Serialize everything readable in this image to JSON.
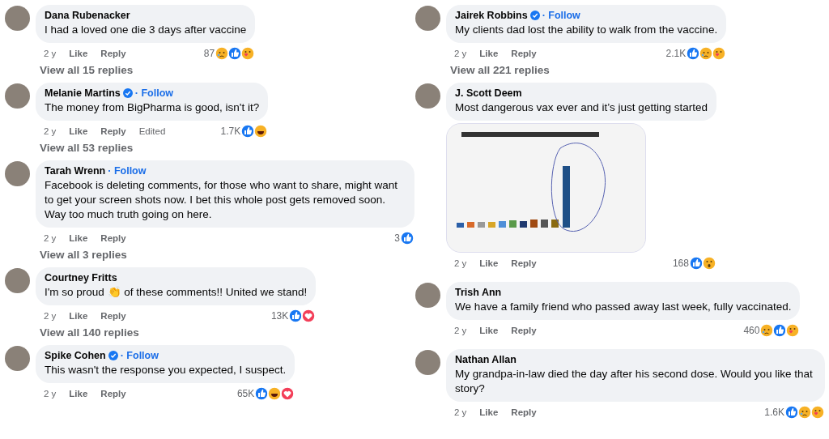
{
  "columns": [
    {
      "comments": [
        {
          "author": "Dana Rubenacker",
          "verified": false,
          "text": "I had a loved one die 3 days after vaccine",
          "time": "2 y",
          "like": "Like",
          "reply": "Reply",
          "count": "87",
          "reactions": [
            {
              "kind": "sad"
            },
            {
              "kind": "like"
            },
            {
              "kind": "care"
            }
          ],
          "view_replies": "View all 15 replies"
        },
        {
          "author": "Melanie Martins",
          "verified": true,
          "follow": "· Follow",
          "text": "The money from BigPharma is good, isn't it?",
          "time": "2 y",
          "like": "Like",
          "reply": "Reply",
          "edited": "Edited",
          "count": "1.7K",
          "reactions": [
            {
              "kind": "like"
            },
            {
              "kind": "haha"
            }
          ],
          "view_replies": "View all 53 replies"
        },
        {
          "author": "Tarah Wrenn",
          "verified": false,
          "follow": "· Follow",
          "text": "Facebook is deleting comments, for those who want to share, might want to get your screen shots now. I bet this whole post gets removed soon. Way too much truth going on here.",
          "time": "2 y",
          "like": "Like",
          "reply": "Reply",
          "count": "3",
          "reactions": [
            {
              "kind": "like"
            }
          ],
          "view_replies": "View all 3 replies"
        },
        {
          "author": "Courtney Fritts",
          "verified": false,
          "text": "I'm so proud 👏 of these comments!! United we stand!",
          "time": "2 y",
          "like": "Like",
          "reply": "Reply",
          "count": "13K",
          "reactions": [
            {
              "kind": "like"
            },
            {
              "kind": "love"
            }
          ],
          "view_replies": "View all 140 replies"
        },
        {
          "author": "Spike Cohen",
          "verified": true,
          "follow": "· Follow",
          "text": "This wasn't the response you expected, I suspect.",
          "time": "2 y",
          "like": "Like",
          "reply": "Reply",
          "count": "65K",
          "reactions": [
            {
              "kind": "like"
            },
            {
              "kind": "haha"
            },
            {
              "kind": "love"
            }
          ]
        }
      ]
    },
    {
      "comments": [
        {
          "author": "Jairek Robbins",
          "verified": true,
          "follow": "· Follow",
          "text": "My clients dad lost the ability to walk from the vaccine.",
          "time": "2 y",
          "like": "Like",
          "reply": "Reply",
          "count": "2.1K",
          "reactions": [
            {
              "kind": "like"
            },
            {
              "kind": "sad"
            },
            {
              "kind": "care"
            }
          ],
          "view_replies": "View all 221 replies"
        },
        {
          "author": "J. Scott Deem",
          "verified": false,
          "text": "Most dangerous vax ever and it’s just getting started",
          "image": true,
          "time": "2 y",
          "like": "Like",
          "reply": "Reply",
          "count": "168",
          "reactions": [
            {
              "kind": "like"
            },
            {
              "kind": "wow"
            }
          ]
        },
        {
          "author": "Trish Ann",
          "verified": false,
          "text": "We have a family friend who passed away last week, fully vaccinated.",
          "time": "2 y",
          "like": "Like",
          "reply": "Reply",
          "count": "460",
          "reactions": [
            {
              "kind": "sad"
            },
            {
              "kind": "like"
            },
            {
              "kind": "care"
            }
          ]
        },
        {
          "author": "Nathan Allan",
          "verified": false,
          "text": "My grandpa-in-law died the day after his second dose. Would you like that story?",
          "time": "2 y",
          "like": "Like",
          "reply": "Reply",
          "count": "1.6K",
          "reactions": [
            {
              "kind": "like"
            },
            {
              "kind": "sad"
            },
            {
              "kind": "care"
            }
          ]
        }
      ]
    }
  ]
}
